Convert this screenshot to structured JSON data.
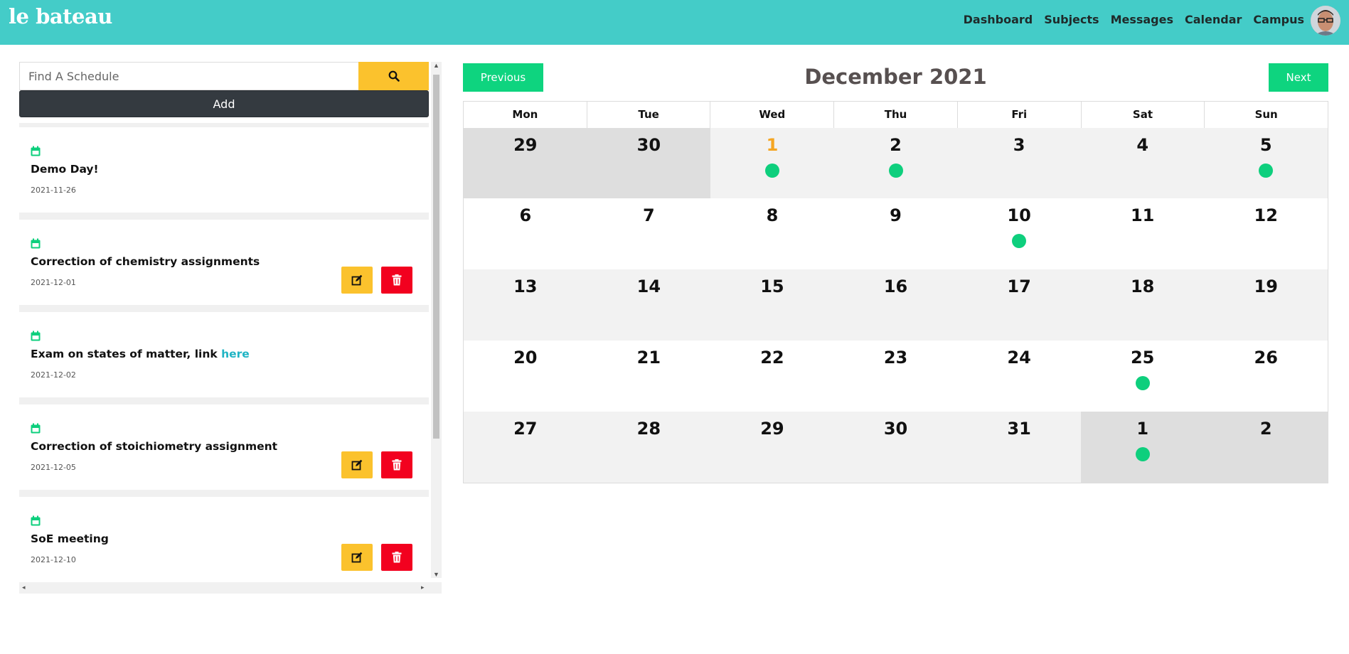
{
  "header": {
    "brand": "le bateau",
    "nav": [
      "Dashboard",
      "Subjects",
      "Messages",
      "Calendar",
      "Campus"
    ]
  },
  "sidebar": {
    "search_placeholder": "Find A Schedule",
    "add_label": "Add",
    "items": [
      {
        "title": "Demo Day!",
        "link_text": "",
        "date": "2021-11-26",
        "actions": false
      },
      {
        "title": "Correction of chemistry assignments",
        "link_text": "",
        "date": "2021-12-01",
        "actions": true
      },
      {
        "title": "Exam on states of matter, link ",
        "link_text": "here",
        "date": "2021-12-02",
        "actions": false
      },
      {
        "title": "Correction of stoichiometry assignment",
        "link_text": "",
        "date": "2021-12-05",
        "actions": true
      },
      {
        "title": "SoE meeting",
        "link_text": "",
        "date": "2021-12-10",
        "actions": true
      }
    ]
  },
  "calendar": {
    "prev_label": "Previous",
    "next_label": "Next",
    "month_label": "December 2021",
    "weekdays": [
      "Mon",
      "Tue",
      "Wed",
      "Thu",
      "Fri",
      "Sat",
      "Sun"
    ],
    "weeks": [
      [
        {
          "d": "29",
          "bg": "dark",
          "dot": false
        },
        {
          "d": "30",
          "bg": "dark",
          "dot": false
        },
        {
          "d": "1",
          "bg": "gray",
          "dot": true,
          "today": true
        },
        {
          "d": "2",
          "bg": "gray",
          "dot": true
        },
        {
          "d": "3",
          "bg": "gray",
          "dot": false
        },
        {
          "d": "4",
          "bg": "gray",
          "dot": false
        },
        {
          "d": "5",
          "bg": "gray",
          "dot": true
        }
      ],
      [
        {
          "d": "6",
          "bg": "white",
          "dot": false
        },
        {
          "d": "7",
          "bg": "white",
          "dot": false
        },
        {
          "d": "8",
          "bg": "white",
          "dot": false
        },
        {
          "d": "9",
          "bg": "white",
          "dot": false
        },
        {
          "d": "10",
          "bg": "white",
          "dot": true
        },
        {
          "d": "11",
          "bg": "white",
          "dot": false
        },
        {
          "d": "12",
          "bg": "white",
          "dot": false
        }
      ],
      [
        {
          "d": "13",
          "bg": "gray",
          "dot": false
        },
        {
          "d": "14",
          "bg": "gray",
          "dot": false
        },
        {
          "d": "15",
          "bg": "gray",
          "dot": false
        },
        {
          "d": "16",
          "bg": "gray",
          "dot": false
        },
        {
          "d": "17",
          "bg": "gray",
          "dot": false
        },
        {
          "d": "18",
          "bg": "gray",
          "dot": false
        },
        {
          "d": "19",
          "bg": "gray",
          "dot": false
        }
      ],
      [
        {
          "d": "20",
          "bg": "white",
          "dot": false
        },
        {
          "d": "21",
          "bg": "white",
          "dot": false
        },
        {
          "d": "22",
          "bg": "white",
          "dot": false
        },
        {
          "d": "23",
          "bg": "white",
          "dot": false
        },
        {
          "d": "24",
          "bg": "white",
          "dot": false
        },
        {
          "d": "25",
          "bg": "white",
          "dot": true
        },
        {
          "d": "26",
          "bg": "white",
          "dot": false
        }
      ],
      [
        {
          "d": "27",
          "bg": "gray",
          "dot": false
        },
        {
          "d": "28",
          "bg": "gray",
          "dot": false
        },
        {
          "d": "29",
          "bg": "gray",
          "dot": false
        },
        {
          "d": "30",
          "bg": "gray",
          "dot": false
        },
        {
          "d": "31",
          "bg": "gray",
          "dot": false
        },
        {
          "d": "1",
          "bg": "dark",
          "dot": true
        },
        {
          "d": "2",
          "bg": "dark",
          "dot": false
        }
      ]
    ]
  },
  "colors": {
    "navbar": "#44ccc8",
    "accent_green": "#0ed47f",
    "edit_yellow": "#fbc22d",
    "delete_red": "#f2011f",
    "today_orange": "#f5a623"
  }
}
